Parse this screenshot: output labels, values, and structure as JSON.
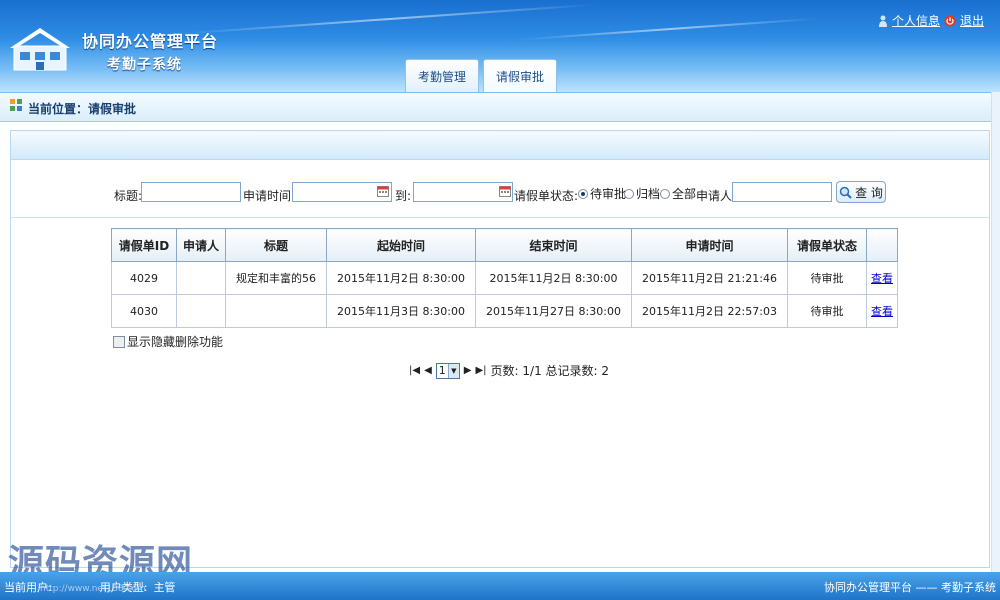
{
  "header": {
    "app_title": "协同办公管理平台",
    "app_subtitle": "考勤子系统",
    "links": {
      "profile": "个人信息",
      "logout": "退出"
    },
    "tabs": [
      {
        "label": "考勤管理",
        "active": false
      },
      {
        "label": "请假审批",
        "active": true
      }
    ]
  },
  "breadcrumb": {
    "text": "当前位置：请假审批"
  },
  "search": {
    "title_label": "标题:",
    "title_value": "",
    "apply_time_label": "申请时间:",
    "apply_time_from": "",
    "to_label": "到:",
    "apply_time_to": "",
    "status_label": "请假单状态:",
    "status_options": [
      {
        "label": "待审批",
        "checked": true
      },
      {
        "label": "归档",
        "checked": false
      },
      {
        "label": "全部",
        "checked": false
      }
    ],
    "applicant_label": "申请人:",
    "applicant_value": "",
    "query_button": "查 询"
  },
  "table": {
    "columns": [
      "请假单ID",
      "申请人",
      "标题",
      "起始时间",
      "结束时间",
      "申请时间",
      "请假单状态",
      ""
    ],
    "rows": [
      {
        "id": "4029",
        "applicant": "",
        "title": "规定和丰富的56",
        "start": "2015年11月2日 8:30:00",
        "end": "2015年11月2日 8:30:00",
        "applied": "2015年11月2日 21:21:46",
        "status": "待审批",
        "action": "查看"
      },
      {
        "id": "4030",
        "applicant": "",
        "title": "",
        "start": "2015年11月3日 8:30:00",
        "end": "2015年11月27日 8:30:00",
        "applied": "2015年11月2日 22:57:03",
        "status": "待审批",
        "action": "查看"
      }
    ]
  },
  "options": {
    "show_hidden_delete": "显示隐藏删除功能",
    "show_hidden_delete_checked": false
  },
  "pager": {
    "current_page": "1",
    "summary": "页数: 1/1 总记录数: 2"
  },
  "footer": {
    "current_user_label": "当前用户:",
    "user_type_label": "用户类型:",
    "user_type_value": "主管",
    "system_name": "协同办公管理平台 —— 考勤子系统"
  },
  "watermark": {
    "text": "源码资源网",
    "url": "http://www.net188.com"
  },
  "colors": {
    "header_blue": "#1a6fcf",
    "footer_blue": "#1f74c8",
    "link_blue": "#0000cc"
  }
}
